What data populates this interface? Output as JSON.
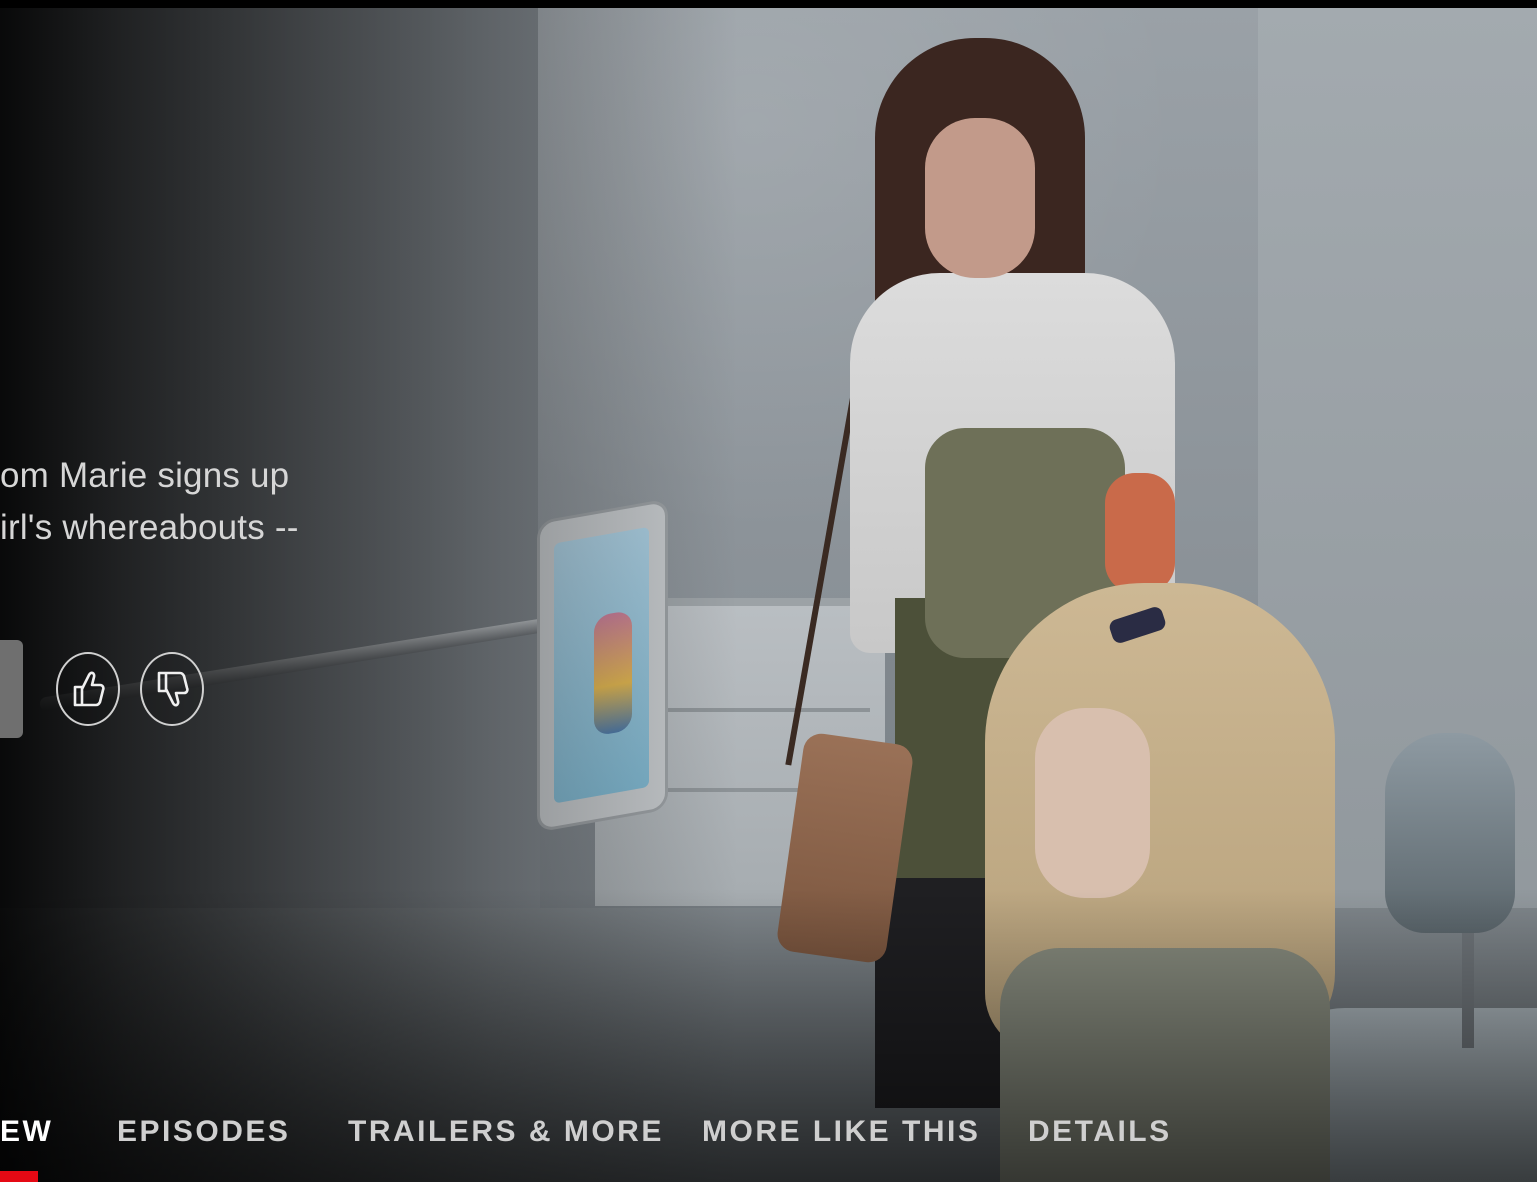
{
  "synopsis": {
    "line1": "om Marie signs up",
    "line2": "irl's whereabouts --"
  },
  "rating": {
    "thumbs_up_icon": "thumbs-up-icon",
    "thumbs_down_icon": "thumbs-down-icon"
  },
  "tabs": [
    {
      "label": "EW",
      "active": true
    },
    {
      "label": "EPISODES",
      "active": false
    },
    {
      "label": "TRAILERS & MORE",
      "active": false
    },
    {
      "label": "MORE LIKE THIS",
      "active": false
    },
    {
      "label": "DETAILS",
      "active": false
    }
  ],
  "colors": {
    "accent": "#e50914",
    "text": "#cfcfcf",
    "background": "#0b0b0b"
  }
}
